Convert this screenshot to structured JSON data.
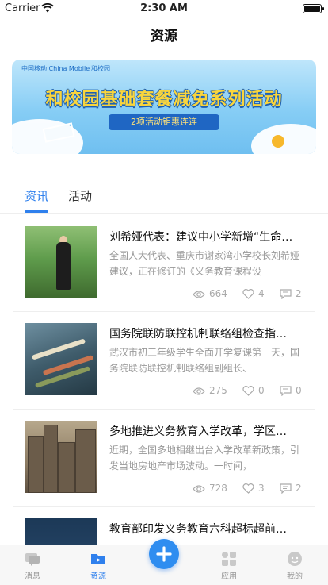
{
  "status_bar": {
    "carrier": "Carrier",
    "time": "2:30 AM"
  },
  "page": {
    "title": "资源"
  },
  "banner": {
    "logo_text": "中国移动 China Mobile",
    "brand_text": "和校园",
    "headline": "和校园基础套餐减免系列活动",
    "subline": "2项活动钜惠连连"
  },
  "tabs": [
    {
      "label": "资讯",
      "active": true
    },
    {
      "label": "活动",
      "active": false
    }
  ],
  "news": [
    {
      "title": "刘希娅代表：建议中小学新增“生命…",
      "summary": "全国人大代表、重庆市谢家湾小学校长刘希娅建议，正在修订的《义务教育课程设",
      "views": "664",
      "likes": "4",
      "comments": "2",
      "image": "woman-in-field-photo"
    },
    {
      "title": "国务院联防联控机制联络组检查指…",
      "summary": "武汉市初三年级学生全面开学复课第一天，国务院联防联控机制联络组副组长、",
      "views": "275",
      "likes": "0",
      "comments": "0",
      "image": "pencils-photo"
    },
    {
      "title": "多地推进义务教育入学改革，学区…",
      "summary": "近期，全国多地相继出台入学改革新政策，引发当地房地产市场波动。一时间，",
      "views": "728",
      "likes": "3",
      "comments": "2",
      "image": "city-buildings-photo"
    },
    {
      "title": "教育部印发义务教育六科超标超前…",
      "summary": "",
      "image": "night-sky-photo"
    }
  ],
  "tabbar": {
    "items": [
      {
        "label": "消息",
        "icon": "message-icon",
        "active": false
      },
      {
        "label": "资源",
        "icon": "video-folder-icon",
        "active": true
      },
      {
        "label": "应用",
        "icon": "apps-icon",
        "active": false
      },
      {
        "label": "我的",
        "icon": "profile-icon",
        "active": false
      }
    ],
    "fab_icon": "plus-icon"
  },
  "colors": {
    "accent": "#2f80ed",
    "muted": "#999999"
  }
}
